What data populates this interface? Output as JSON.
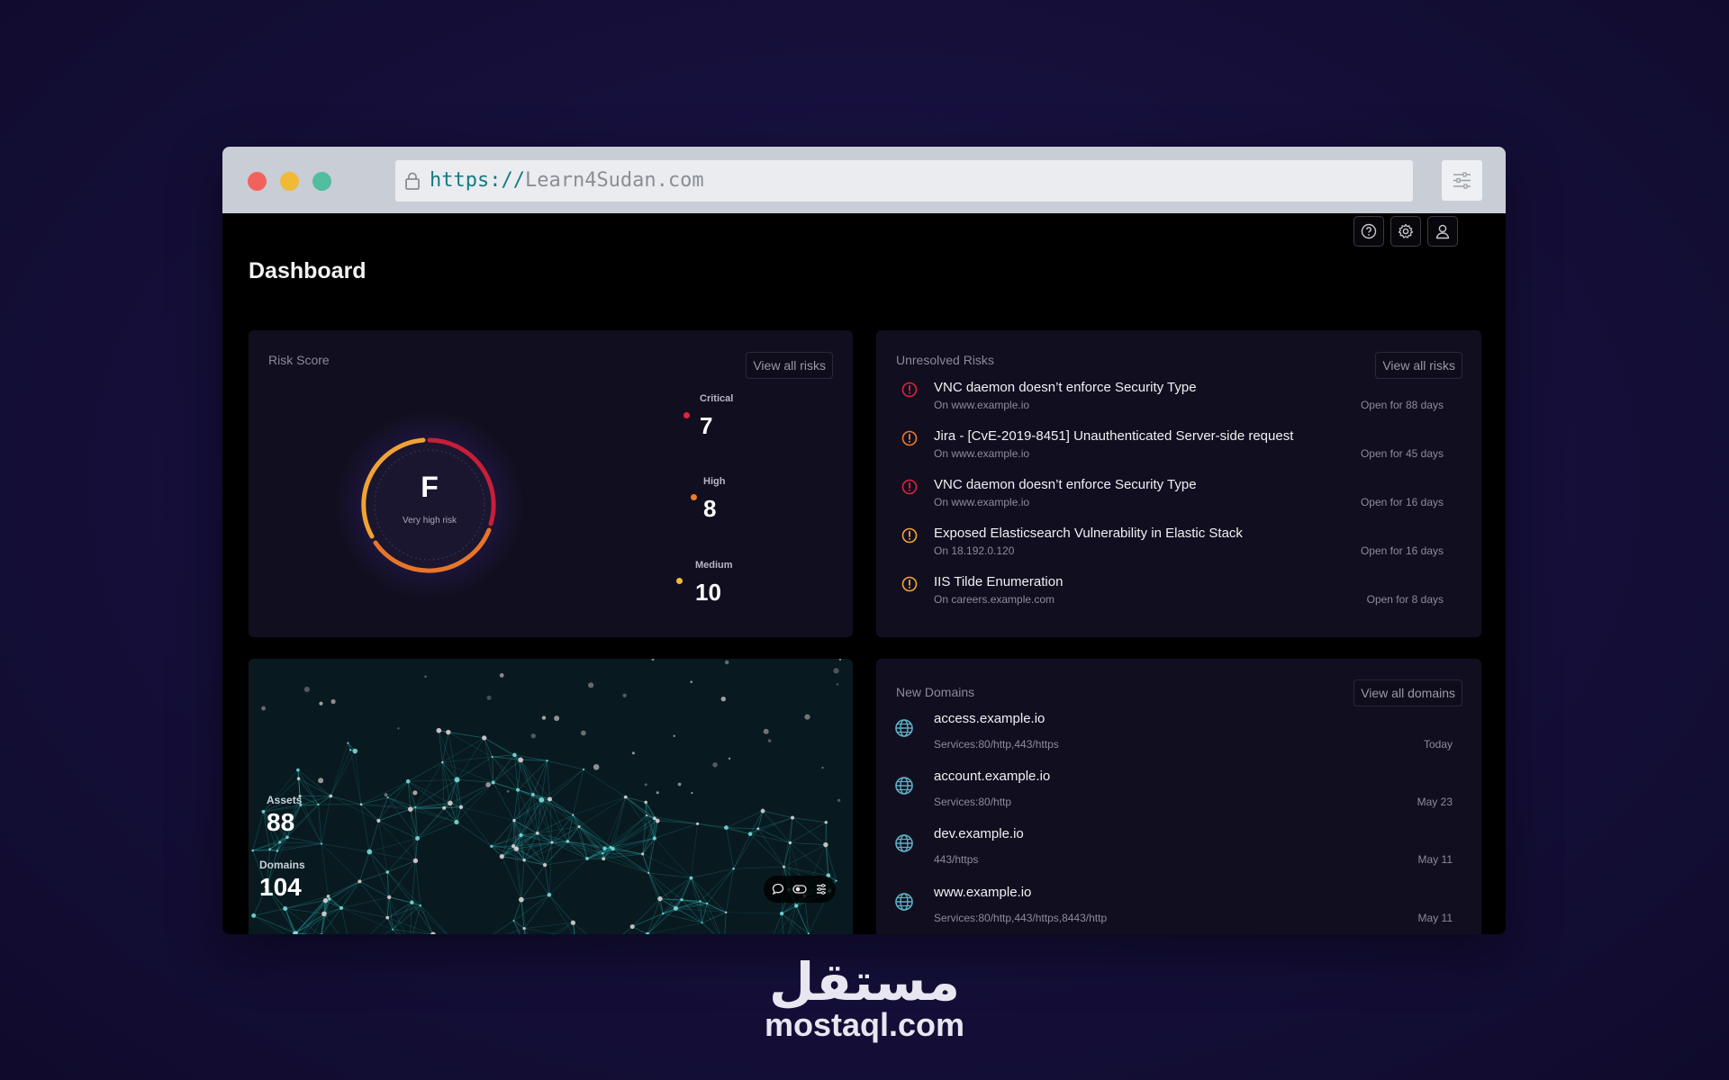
{
  "browser": {
    "url_scheme": "https://",
    "url_host": "Learn4Sudan.com"
  },
  "page": {
    "title": "Dashboard"
  },
  "header_icons": [
    "help-icon",
    "gear-icon",
    "user-icon"
  ],
  "risk_score": {
    "title": "Risk Score",
    "view_all": "View all risks",
    "grade": "F",
    "grade_label": "Very high risk",
    "severities": [
      {
        "label": "Critical",
        "value": "7",
        "color": "#e0233b"
      },
      {
        "label": "High",
        "value": "8",
        "color": "#f07a2a"
      },
      {
        "label": "Medium",
        "value": "10",
        "color": "#f5b73a"
      }
    ]
  },
  "unresolved_risks": {
    "title": "Unresolved Risks",
    "view_all": "View all risks",
    "items": [
      {
        "title": "VNC daemon doesn’t enforce Security Type",
        "target": "On www.example.io",
        "age": "Open for 88 days",
        "color": "#e0233b"
      },
      {
        "title": "Jira - [CvE-2019-8451] Unauthenticated Server-side request",
        "target": "On www.example.io",
        "age": "Open for 45 days",
        "color": "#f07a2a"
      },
      {
        "title": "VNC daemon doesn’t enforce Security Type",
        "target": "On www.example.io",
        "age": "Open for 16 days",
        "color": "#e0233b"
      },
      {
        "title": "Exposed Elasticsearch Vulnerability in Elastic Stack",
        "target": "On 18.192.0.120",
        "age": "Open for 16 days",
        "color": "#f5a33a"
      },
      {
        "title": "IIS Tilde Enumeration",
        "target": "On careers.example.com",
        "age": "Open for 8 days",
        "color": "#f5a33a"
      }
    ]
  },
  "network": {
    "assets_label": "Assets",
    "assets_value": "88",
    "domains_label": "Domains",
    "domains_value": "104",
    "toolbar_icons": [
      "comment-icon",
      "toggle-icon",
      "list-icon"
    ]
  },
  "new_domains": {
    "title": "New Domains",
    "view_all": "View all domains",
    "items": [
      {
        "name": "access.example.io",
        "services": "Services:80/http,443/https",
        "date": "Today"
      },
      {
        "name": "account.example.io",
        "services": "Services:80/http",
        "date": "May 23"
      },
      {
        "name": "dev.example.io",
        "services": "443/https",
        "date": "May 11"
      },
      {
        "name": "www.example.io",
        "services": "Services:80/http,443/https,8443/http",
        "date": "May 11"
      }
    ]
  },
  "watermark": {
    "arabic": "مستقل",
    "latin": "mostaql.com"
  }
}
